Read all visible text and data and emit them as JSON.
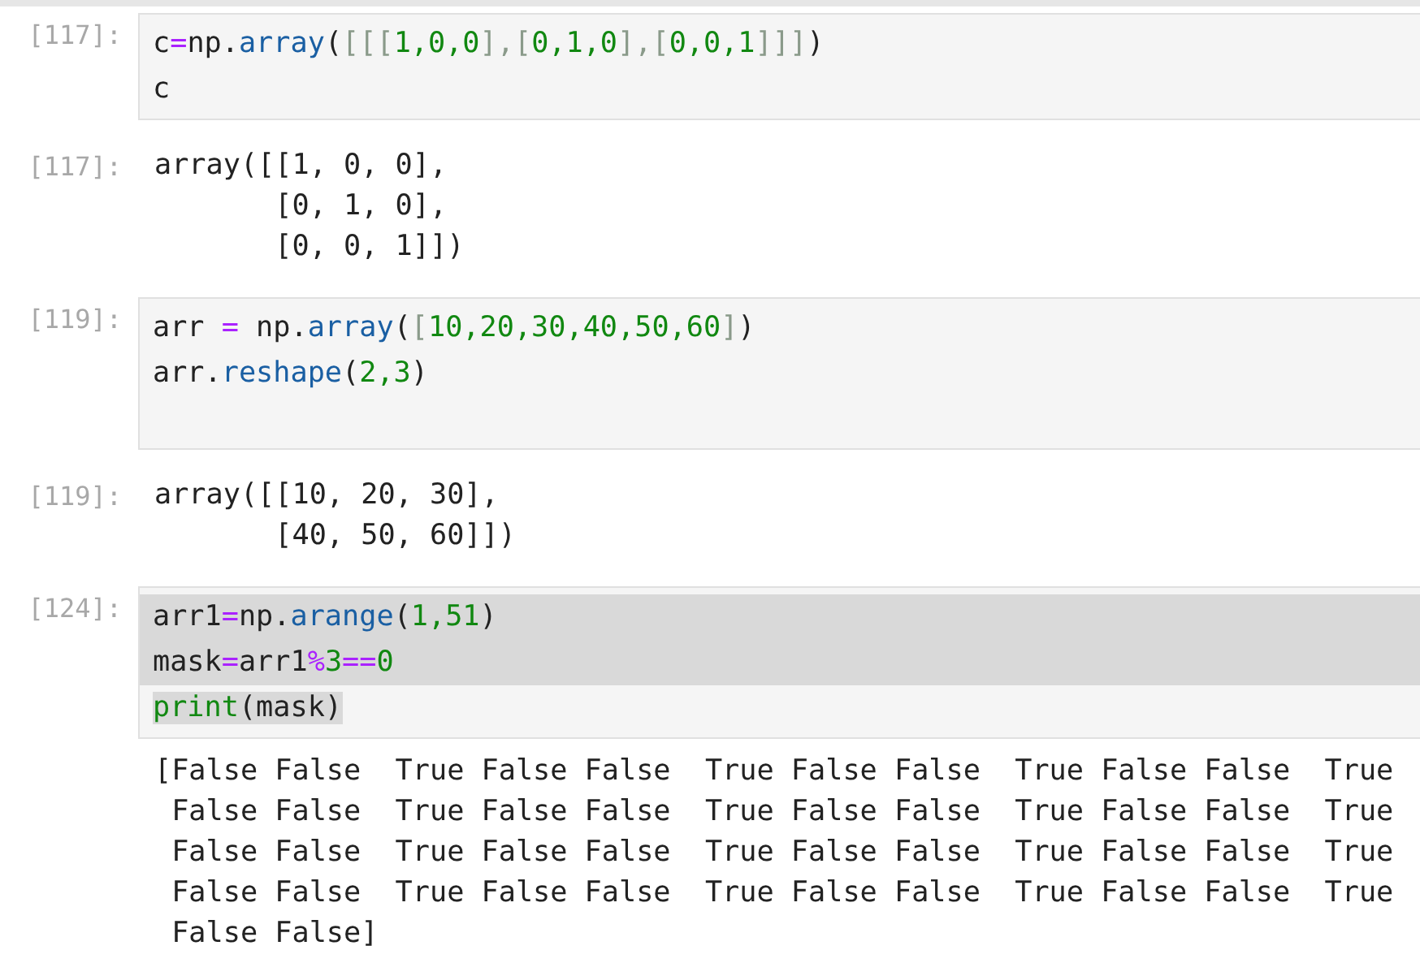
{
  "cells": [
    {
      "kind": "input",
      "prompt": "[117]:",
      "lines": [
        {
          "kind": "plain",
          "tokens": [
            {
              "t": "c",
              "kind": "name"
            },
            {
              "t": "=",
              "kind": "op"
            },
            {
              "t": "np.",
              "kind": "name"
            },
            {
              "t": "array",
              "kind": "func"
            },
            {
              "t": "(",
              "kind": "name"
            },
            {
              "t": "[[[",
              "kind": "bracket"
            },
            {
              "t": "1,0,0",
              "kind": "num"
            },
            {
              "t": "],[",
              "kind": "bracket"
            },
            {
              "t": "0,1,0",
              "kind": "num"
            },
            {
              "t": "],[",
              "kind": "bracket"
            },
            {
              "t": "0,0,1",
              "kind": "num"
            },
            {
              "t": "]]]",
              "kind": "bracket"
            },
            {
              "t": ")",
              "kind": "name"
            }
          ]
        },
        {
          "kind": "plain",
          "tokens": [
            {
              "t": "c",
              "kind": "name"
            }
          ]
        }
      ]
    },
    {
      "kind": "output",
      "prompt": "[117]:",
      "lines": [
        "array([[1, 0, 0],",
        "       [0, 1, 0],",
        "       [0, 0, 1]])"
      ]
    },
    {
      "kind": "input",
      "prompt": "[119]:",
      "lines": [
        {
          "kind": "plain",
          "tokens": [
            {
              "t": "arr ",
              "kind": "name"
            },
            {
              "t": "=",
              "kind": "op"
            },
            {
              "t": " np.",
              "kind": "name"
            },
            {
              "t": "array",
              "kind": "func"
            },
            {
              "t": "(",
              "kind": "name"
            },
            {
              "t": "[",
              "kind": "bracket"
            },
            {
              "t": "10,20,30,40,50,60",
              "kind": "num"
            },
            {
              "t": "]",
              "kind": "bracket"
            },
            {
              "t": ")",
              "kind": "name"
            }
          ]
        },
        {
          "kind": "plain",
          "tokens": [
            {
              "t": "arr.",
              "kind": "name"
            },
            {
              "t": "reshape",
              "kind": "func"
            },
            {
              "t": "(",
              "kind": "name"
            },
            {
              "t": "2,3",
              "kind": "num"
            },
            {
              "t": ")",
              "kind": "name"
            }
          ]
        },
        {
          "kind": "blank"
        }
      ]
    },
    {
      "kind": "output",
      "prompt": "[119]:",
      "lines": [
        "array([[10, 20, 30],",
        "       [40, 50, 60]])"
      ]
    },
    {
      "kind": "input",
      "prompt": "[124]:",
      "lines": [
        {
          "kind": "selected",
          "tokens": [
            {
              "t": "arr1",
              "kind": "name"
            },
            {
              "t": "=",
              "kind": "op"
            },
            {
              "t": "np.",
              "kind": "name"
            },
            {
              "t": "arange",
              "kind": "func"
            },
            {
              "t": "(",
              "kind": "name"
            },
            {
              "t": "1,51",
              "kind": "num"
            },
            {
              "t": ")",
              "kind": "name"
            }
          ]
        },
        {
          "kind": "selected",
          "tokens": [
            {
              "t": "mask",
              "kind": "name"
            },
            {
              "t": "=",
              "kind": "op"
            },
            {
              "t": "arr1",
              "kind": "name"
            },
            {
              "t": "%",
              "kind": "op"
            },
            {
              "t": "3",
              "kind": "num"
            },
            {
              "t": "==",
              "kind": "op"
            },
            {
              "t": "0",
              "kind": "num"
            }
          ]
        },
        {
          "kind": "selected_end",
          "tokens": [
            {
              "t": "print",
              "kind": "builtin"
            },
            {
              "t": "(mask)",
              "kind": "name"
            }
          ]
        }
      ]
    },
    {
      "kind": "stream",
      "lines": [
        "[False False  True False False  True False False  True False False  True",
        " False False  True False False  True False False  True False False  True",
        " False False  True False False  True False False  True False False  True",
        " False False  True False False  True False False  True False False  True",
        " False False]"
      ]
    }
  ]
}
